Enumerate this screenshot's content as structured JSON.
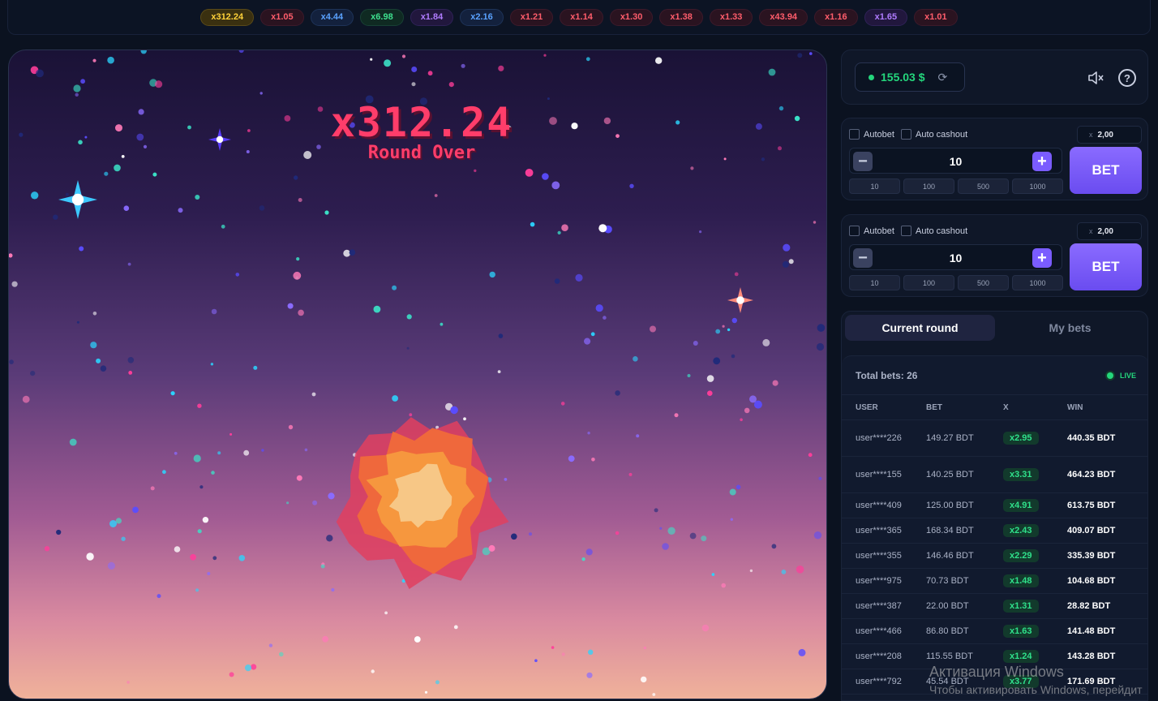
{
  "history": [
    {
      "label": "x312.24",
      "color": "gold"
    },
    {
      "label": "x1.05",
      "color": "red"
    },
    {
      "label": "x4.44",
      "color": "blue"
    },
    {
      "label": "x6.98",
      "color": "green"
    },
    {
      "label": "x1.84",
      "color": "purple"
    },
    {
      "label": "x2.16",
      "color": "blue"
    },
    {
      "label": "x1.21",
      "color": "red"
    },
    {
      "label": "x1.14",
      "color": "red"
    },
    {
      "label": "x1.30",
      "color": "red"
    },
    {
      "label": "x1.38",
      "color": "red"
    },
    {
      "label": "x1.33",
      "color": "red"
    },
    {
      "label": "x43.94",
      "color": "red"
    },
    {
      "label": "x1.16",
      "color": "red"
    },
    {
      "label": "x1.65",
      "color": "purple"
    },
    {
      "label": "x1.01",
      "color": "red"
    }
  ],
  "game": {
    "multiplier": "x312.24",
    "status": "Round Over"
  },
  "balance": {
    "amount": "155.03 $",
    "refresh_icon": "refresh-icon",
    "mute_icon": "speaker-muted-icon",
    "help_icon": "question-icon",
    "help_glyph": "?"
  },
  "bet_panels": [
    {
      "autobet_label": "Autobet",
      "autocashout_label": "Auto cashout",
      "odds_prefix": "x",
      "odds": "2,00",
      "amount": "10",
      "minus": "−",
      "plus": "+",
      "quick": [
        "10",
        "100",
        "500",
        "1000"
      ],
      "bet_label": "BET"
    },
    {
      "autobet_label": "Autobet",
      "autocashout_label": "Auto cashout",
      "odds_prefix": "x",
      "odds": "2,00",
      "amount": "10",
      "minus": "−",
      "plus": "+",
      "quick": [
        "10",
        "100",
        "500",
        "1000"
      ],
      "bet_label": "BET"
    }
  ],
  "tabs": {
    "current": "Current round",
    "mine": "My bets"
  },
  "bets": {
    "total_label": "Total bets: 26",
    "live_label": "LIVE",
    "headers": {
      "user": "USER",
      "bet": "BET",
      "x": "X",
      "win": "WIN"
    },
    "rows": [
      {
        "user": "user****226",
        "bet": "149.27 BDT",
        "x": "x2.95",
        "win": "440.35 BDT"
      },
      {
        "user": "user****155",
        "bet": "140.25 BDT",
        "x": "x3.31",
        "win": "464.23 BDT"
      },
      {
        "user": "user****409",
        "bet": "125.00 BDT",
        "x": "x4.91",
        "win": "613.75 BDT"
      },
      {
        "user": "user****365",
        "bet": "168.34 BDT",
        "x": "x2.43",
        "win": "409.07 BDT"
      },
      {
        "user": "user****355",
        "bet": "146.46 BDT",
        "x": "x2.29",
        "win": "335.39 BDT"
      },
      {
        "user": "user****975",
        "bet": "70.73 BDT",
        "x": "x1.48",
        "win": "104.68 BDT"
      },
      {
        "user": "user****387",
        "bet": "22.00 BDT",
        "x": "x1.31",
        "win": "28.82 BDT"
      },
      {
        "user": "user****466",
        "bet": "86.80 BDT",
        "x": "x1.63",
        "win": "141.48 BDT"
      },
      {
        "user": "user****208",
        "bet": "115.55 BDT",
        "x": "x1.24",
        "win": "143.28 BDT"
      },
      {
        "user": "user****792",
        "bet": "45.54 BDT",
        "x": "x3.77",
        "win": "171.69 BDT"
      }
    ]
  },
  "watermark": {
    "line1": "Активация Windows",
    "line2": "Чтобы активировать Windows, перейдит"
  }
}
